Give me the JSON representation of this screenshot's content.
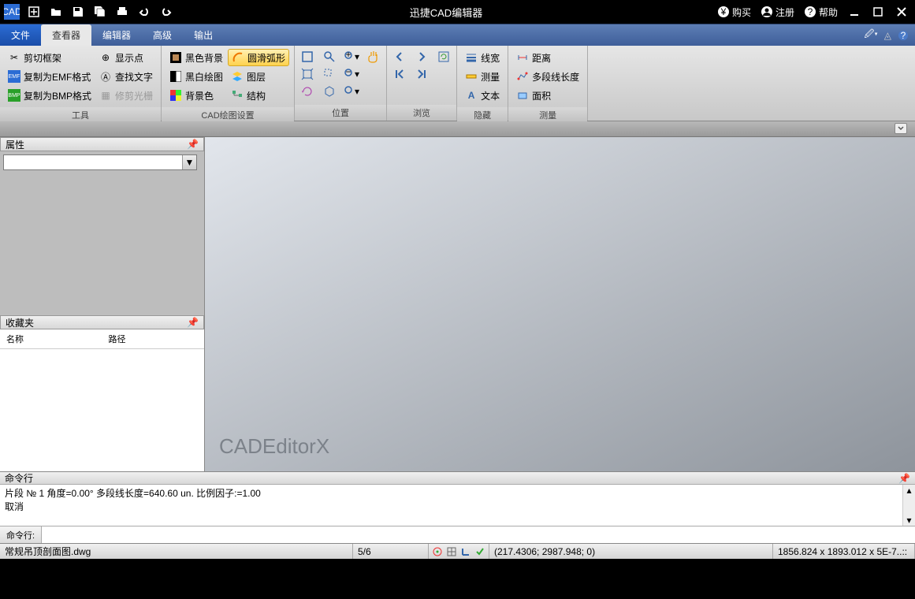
{
  "title": "迅捷CAD编辑器",
  "titlebar_right": {
    "buy": "购买",
    "register": "注册",
    "help": "帮助"
  },
  "tabs": {
    "file": "文件",
    "viewer": "查看器",
    "editor": "编辑器",
    "advanced": "高级",
    "output": "输出"
  },
  "ribbon": {
    "tools": {
      "label": "工具",
      "clip_frame": "剪切框架",
      "copy_emf": "复制为EMF格式",
      "copy_bmp": "复制为BMP格式",
      "show_points": "显示点",
      "find_text": "查找文字",
      "fix_raster": "修剪光栅"
    },
    "cad": {
      "label": "CAD绘图设置",
      "black_bg": "黑色背景",
      "bw_draw": "黑白绘图",
      "bg_color": "背景色",
      "smooth_arc": "圆滑弧形",
      "layers": "图层",
      "structure": "结构"
    },
    "position": {
      "label": "位置"
    },
    "browse": {
      "label": "浏览"
    },
    "hide": {
      "label": "隐藏",
      "linewidth": "线宽",
      "measure": "测量",
      "text": "文本"
    },
    "measure": {
      "label": "测量",
      "distance": "距离",
      "polyline_len": "多段线长度",
      "area": "面积"
    }
  },
  "panels": {
    "properties": "属性",
    "favorites": "收藏夹",
    "fav_name": "名称",
    "fav_path": "路径",
    "commandline": "命令行",
    "cmd_label": "命令行:"
  },
  "canvas_watermark": "CADEditorX",
  "cmd_output": {
    "line1": "片段 № 1 角度=0.00° 多段线长度=640.60 un. 比例因子:=1.00",
    "line2": "取消"
  },
  "statusbar": {
    "filename": "常规吊顶剖面图.dwg",
    "page": "5/6",
    "coords": "(217.4306; 2987.948; 0)",
    "dims": "1856.824 x 1893.012 x 5E-7..::"
  }
}
